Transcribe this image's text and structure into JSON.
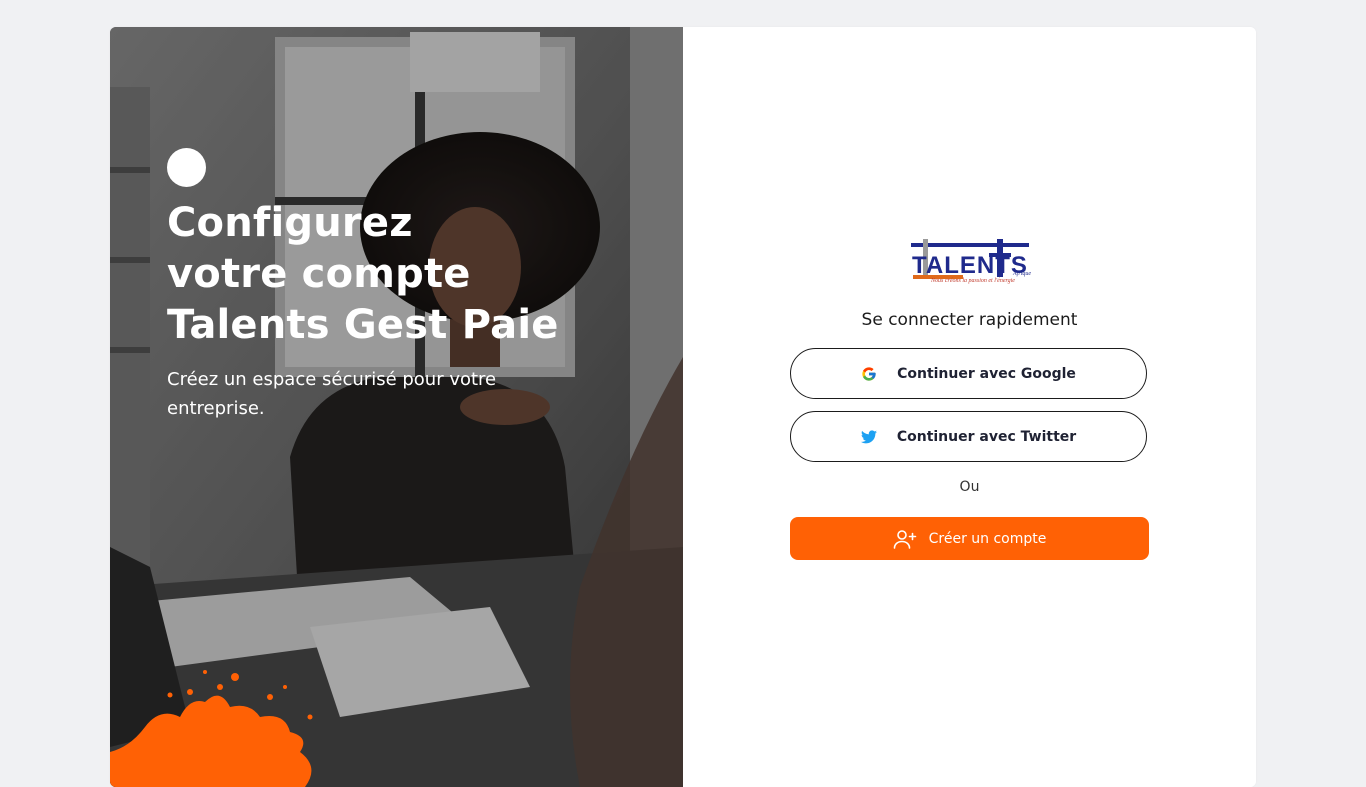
{
  "hero": {
    "title_lines": [
      "Configurez",
      "votre compte",
      "Talents Gest Paie"
    ],
    "subtitle": "Créez un espace sécurisé pour votre entreprise."
  },
  "logo": {
    "title": "TALENTS",
    "sub": "Afrique",
    "tagline": "Nous créons la passion et l'énergie"
  },
  "login": {
    "heading": "Se connecter rapidement",
    "google_label": "Continuer avec Google",
    "twitter_label": "Continuer avec Twitter",
    "separator": "Ou",
    "create_label": "Créer un compte"
  },
  "colors": {
    "accent": "#ff6105",
    "twitter": "#1da1f2",
    "logo_blue": "#1f2a8c",
    "page_bg": "#f0f1f3"
  },
  "icons": {
    "google": "google-icon",
    "twitter": "twitter-icon",
    "create": "user-plus-icon"
  }
}
